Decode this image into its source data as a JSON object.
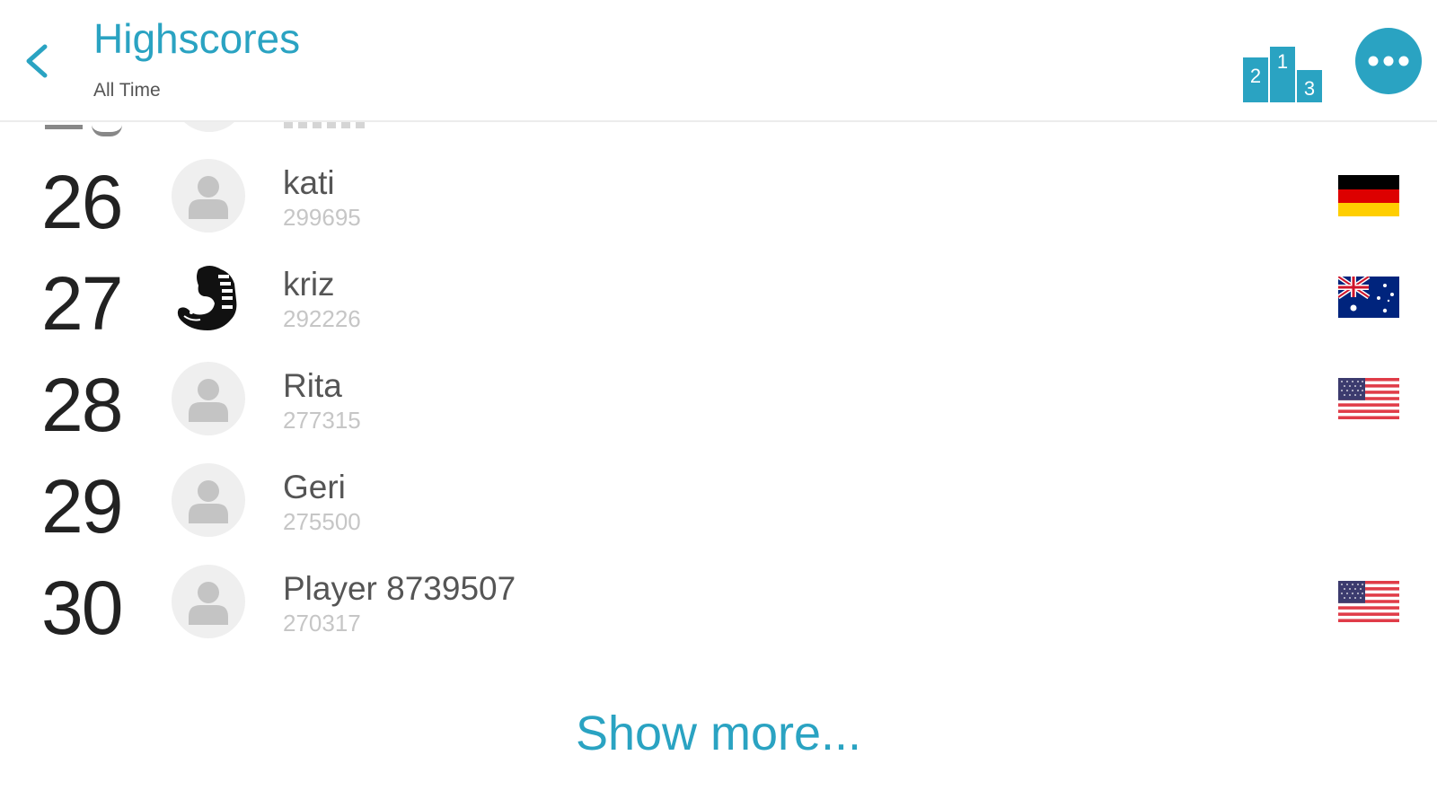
{
  "header": {
    "back_icon": "chevron-left-icon",
    "title": "Highscores",
    "subtitle": "All Time",
    "podium_icon": "podium-icon",
    "podium_labels": {
      "first": "1",
      "second": "2",
      "third": "3"
    },
    "more_icon": "more-horizontal-icon"
  },
  "colors": {
    "accent": "#2aa3c2",
    "rank_text": "#222222",
    "name_text": "#555555",
    "score_text": "#c6c6c6",
    "avatar_bg": "#efefef",
    "avatar_fg": "#c4c4c4"
  },
  "leaderboard": {
    "rows": [
      {
        "rank": "26",
        "name": "kati",
        "score": "299695",
        "avatar": "default-avatar-icon",
        "flag": "germany-flag-icon"
      },
      {
        "rank": "27",
        "name": "kriz",
        "score": "292226",
        "avatar": "custom-avatar-image",
        "flag": "australia-flag-icon"
      },
      {
        "rank": "28",
        "name": "Rita",
        "score": "277315",
        "avatar": "default-avatar-icon",
        "flag": "usa-flag-icon"
      },
      {
        "rank": "29",
        "name": "Geri",
        "score": "275500",
        "avatar": "default-avatar-icon",
        "flag": ""
      },
      {
        "rank": "30",
        "name": "Player 8739507",
        "score": "270317",
        "avatar": "default-avatar-icon",
        "flag": "usa-flag-icon"
      }
    ]
  },
  "footer": {
    "show_more_label": "Show more..."
  }
}
